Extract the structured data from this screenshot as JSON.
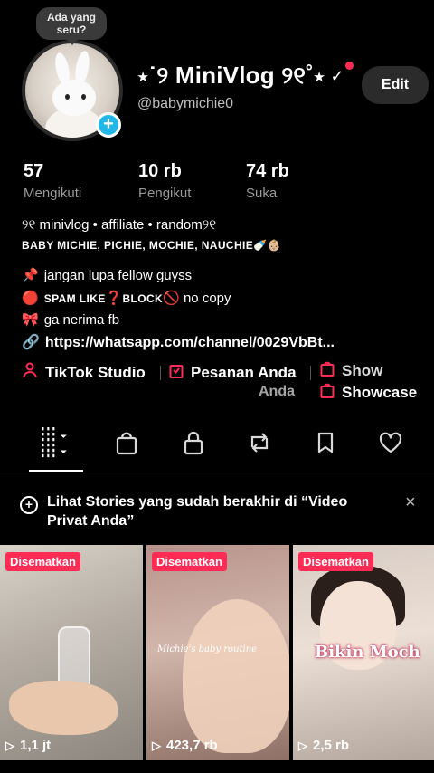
{
  "profile": {
    "bubble_text": "Ada yang seru?",
    "display_name": "⋆˙୨ MiniVlog ୨୧˚⋆",
    "verified_glyph": "✓",
    "handle": "@babymichie0",
    "edit_label": "Edit"
  },
  "stats": [
    {
      "value": "57",
      "label": "Mengikuti"
    },
    {
      "value": "10 rb",
      "label": "Pengikut"
    },
    {
      "value": "74 rb",
      "label": "Suka"
    }
  ],
  "bio": {
    "line1": "୨୧ minivlog • affiliate • random୨୧",
    "line2": "BABY MICHIE, PICHIE, MOCHIE, NAUCHIE🍼👶🏼",
    "line3": "jangan lupa fellow guyss",
    "line3_icon": "📌",
    "line4_icon": "🔴",
    "line4_spam": "SPAM LIKE",
    "line4_q": "❓",
    "line4_block": "BLOCK",
    "line4_no": "🚫",
    "line4_rest": "no copy",
    "line5_icon": "🎀",
    "line5": "ga nerima fb",
    "link_icon": "🔗",
    "link": "https://whatsapp.com/channel/0029VbBt..."
  },
  "quick_links": {
    "tiktok_studio": "TikTok Studio",
    "pesanan": "Pesanan Anda",
    "showcase_partial": "Show",
    "pesanan_partial": "Anda",
    "showcase": "Showcase"
  },
  "tabs": [
    "videos-grid",
    "shop",
    "private",
    "reposts",
    "saved",
    "liked"
  ],
  "banner": {
    "text": "Lihat Stories yang sudah berakhir di “Video Privat Anda”",
    "close": "×"
  },
  "videos": [
    {
      "pinned": "Disematkan",
      "views": "1,1 jt"
    },
    {
      "pinned": "Disematkan",
      "views": "423,7 rb",
      "caption": "Michie's baby routine"
    },
    {
      "pinned": "Disematkan",
      "views": "2,5 rb",
      "caption": "Bikin Moch"
    }
  ],
  "colors": {
    "accent": "#fe2c55",
    "background": "#000000",
    "plus_badge": "#20b8e8"
  }
}
